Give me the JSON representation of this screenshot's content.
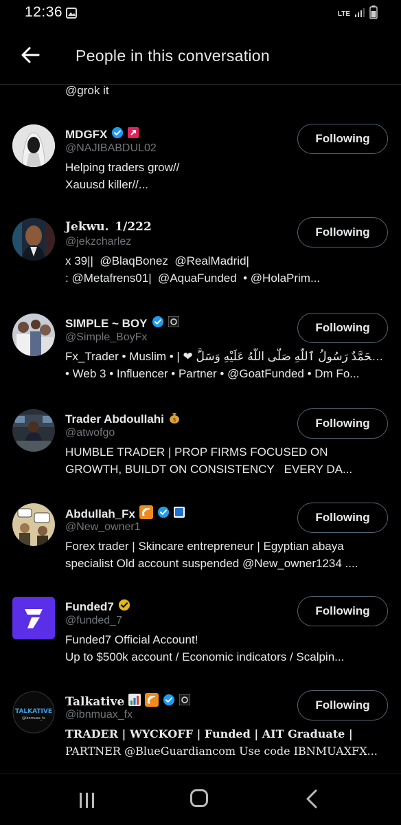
{
  "status": {
    "time": "12:36",
    "network": "LTE"
  },
  "header": {
    "title": "People in this conversation"
  },
  "partial_top": {
    "text": "@grok it"
  },
  "people": [
    {
      "name": "MDGFX",
      "handle": "@NAJIBABDUL02",
      "bio": [
        "Helping traders grow//",
        "Xauusd killer//..."
      ],
      "button": "Following",
      "verified": "blue",
      "avatar": "masked-figure"
    },
    {
      "name": "Jekwu.  1/222",
      "handle": "@jekzcharlez",
      "bio": [
        "x 39||  @BlaqBonez  @RealMadrid|",
        ": @Metafrens01|  @AquaFunded  • @HolaPrim..."
      ],
      "button": "Following",
      "verified": "",
      "avatar": "man-portrait"
    },
    {
      "name": "SIMPLE ~ BOY",
      "handle": "@Simple_BoyFx",
      "bio": [
        "Fx_Trader • Muslim • | ❤ مُحَمَّدٌ رَسُولُ ٱللَّهِ صَلَّى اللَّهُ عَلَيْهِ وَسَلَّ ♡",
        "• Web 3 •  Influencer • Partner • @GoatFunded • Dm Fo..."
      ],
      "button": "Following",
      "verified": "blue",
      "avatar": "group-photo"
    },
    {
      "name": "Trader Abdoullahi",
      "handle": "@atwofgo",
      "bio": [
        "HUMBLE TRADER | PROP FIRMS FOCUSED ON",
        "GROWTH, BUILDT ON CONSISTENCY   EVERY DA..."
      ],
      "button": "Following",
      "verified": "",
      "avatar": "man-at-desk"
    },
    {
      "name": "Abdullah_Fx",
      "handle": "@New_owner1",
      "bio": [
        "Forex trader | Skincare entrepreneur | Egyptian abaya",
        "specialist Old account suspended @New_owner1234 ...."
      ],
      "button": "Following",
      "verified": "blue",
      "avatar": "cartoon-meme"
    },
    {
      "name": "Funded7",
      "handle": "@funded_7",
      "bio": [
        "Funded7 Official Account!",
        "Up to $500k  account / Economic indicators / Scalpin..."
      ],
      "button": "Following",
      "verified": "gold",
      "avatar": "funded7-logo"
    },
    {
      "name": "Talkative",
      "handle": "@ibnmuax_fx",
      "bio": [
        "TRADER | WYCKOFF | Funded | AIT Graduate |",
        "PARTNER @BlueGuardiancom Use code IBNMUAXFX..."
      ],
      "button": "Following",
      "verified": "blue",
      "avatar": "talkative-logo"
    }
  ],
  "avatar_text": {
    "talkative_logo": "TALKATIVE",
    "talkative_sub": "@ibnmuax_fx"
  },
  "colors": {
    "verified_blue": "#1d9bf0",
    "verified_gold": "#e2b719",
    "funded7_purple": "#5b2ee8"
  }
}
